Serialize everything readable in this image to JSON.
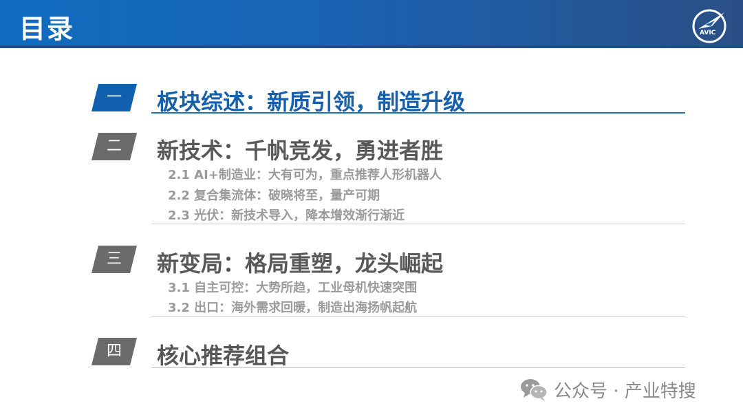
{
  "header": {
    "title": "目录",
    "logo_text": "AVIC",
    "colors": {
      "bar": "#1a63b3",
      "accent": "#1160ad"
    }
  },
  "sections": [
    {
      "badge": "一",
      "title": "板块综述：新质引领，制造升级",
      "active": true,
      "subs": []
    },
    {
      "badge": "二",
      "title": "新技术：千帆竞发，勇进者胜",
      "active": false,
      "subs": [
        "2.1 AI+制造业：大有可为，重点推荐人形机器人",
        "2.2 复合集流体：破晓将至，量产可期",
        "2.3 光伏：新技术导入，降本增效渐行渐近"
      ]
    },
    {
      "badge": "三",
      "title": "新变局：格局重塑，龙头崛起",
      "active": false,
      "subs": [
        "3.1 自主可控：大势所趋，工业母机快速突围",
        "3.2 出口：海外需求回暖，制造出海扬帆起航"
      ]
    },
    {
      "badge": "四",
      "title": "核心推荐组合",
      "active": false,
      "subs": []
    }
  ],
  "watermark": {
    "icon": "wechat-icon",
    "text": "公众号 · 产业特搜"
  }
}
